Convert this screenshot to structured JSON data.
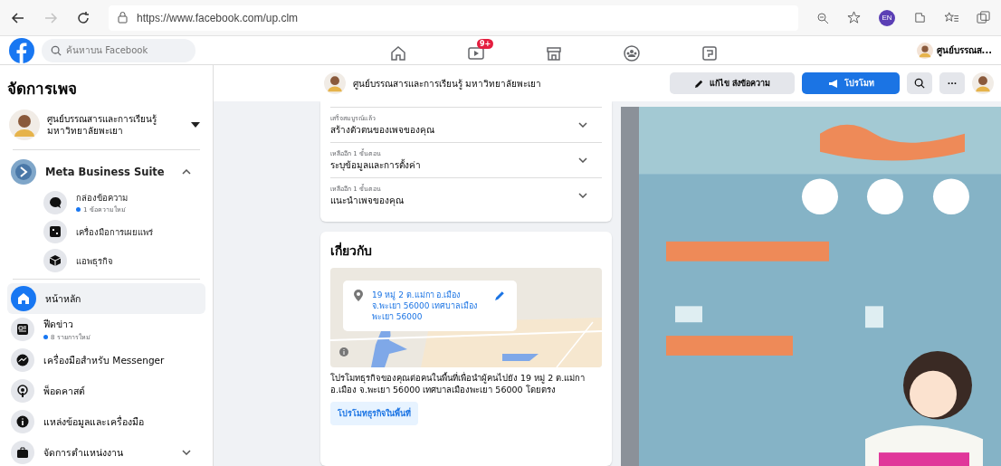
{
  "browser": {
    "url": "https://www.facebook.com/up.clm",
    "forward_disabled": true,
    "profile": "EN"
  },
  "header": {
    "search": {
      "placeholder": "ค้นหาบน Facebook"
    },
    "nav": [
      {
        "kind": "home"
      },
      {
        "kind": "video",
        "badge": "9+"
      },
      {
        "kind": "store"
      },
      {
        "kind": "groups"
      },
      {
        "kind": "pages"
      }
    ],
    "account": "ศูนย์บรรณส..."
  },
  "sidebar": {
    "title": "จัดการเพจ",
    "page_name": "ศูนย์บรรณสารและการเรียนรู้ มหาวิทยาลัยพะเยา",
    "business_suite": {
      "label": "Meta Business Suite",
      "expanded": true,
      "items": [
        {
          "kind": "inbox",
          "label": "กล่องข้อความ",
          "note": "1 ข้อความใหม่"
        },
        {
          "kind": "publish",
          "label": "เครื่องมือการเผยแพร่"
        },
        {
          "kind": "apps",
          "label": "แอพธุรกิจ"
        }
      ]
    },
    "items": [
      {
        "kind": "home",
        "label": "หน้าหลัก",
        "selected": true
      },
      {
        "kind": "feed",
        "label": "ฟีดข่าว",
        "note": "8 รายการใหม่",
        "selected": false
      },
      {
        "kind": "messenger",
        "label": "เครื่องมือสำหรับ Messenger",
        "selected": false
      },
      {
        "kind": "podcast",
        "label": "พ็อดคาสต์",
        "selected": false
      },
      {
        "kind": "info",
        "label": "แหล่งข้อมูลและเครื่องมือ",
        "selected": false
      },
      {
        "kind": "jobs",
        "label": "จัดการตำแหน่งงาน",
        "selected": false,
        "expanded": false
      }
    ]
  },
  "page_header": {
    "name": "ศูนย์บรรณสารและการเรียนรู้ มหาวิทยาลัยพะเยา",
    "edit_button": "แก้ไข ส่งข้อความ",
    "promote_button": "โปรโมท",
    "more_button": "···"
  },
  "setup_steps": [
    {
      "status": "เสร็จสมบูรณ์แล้ว",
      "title": "สร้างตัวตนของเพจของคุณ",
      "expanded": false
    },
    {
      "status": "เหลืออีก 1 ขั้นตอน",
      "title": "ระบุข้อมูลและการตั้งค่า",
      "expanded": false
    },
    {
      "status": "เหลืออีก 1 ขั้นตอน",
      "title": "แนะนำเพจของคุณ",
      "expanded": false
    }
  ],
  "about": {
    "title": "เกี่ยวกับ",
    "address": "19 หมู่ 2 ต.แม่กา อ.เมือง จ.พะเยา 56000 เทศบาลเมืองพะเยา 56000",
    "description": "โปรโมทธุรกิจของคุณต่อคนในพื้นที่เพื่อนำผู้คนไปยัง 19 หมู่ 2 ต.แม่กา อ.เมือง จ.พะเยา 56000 เทศบาลเมืองพะเยา 56000 โดยตรง",
    "promote_button": "โปรโมทธุรกิจในพื้นที่"
  }
}
